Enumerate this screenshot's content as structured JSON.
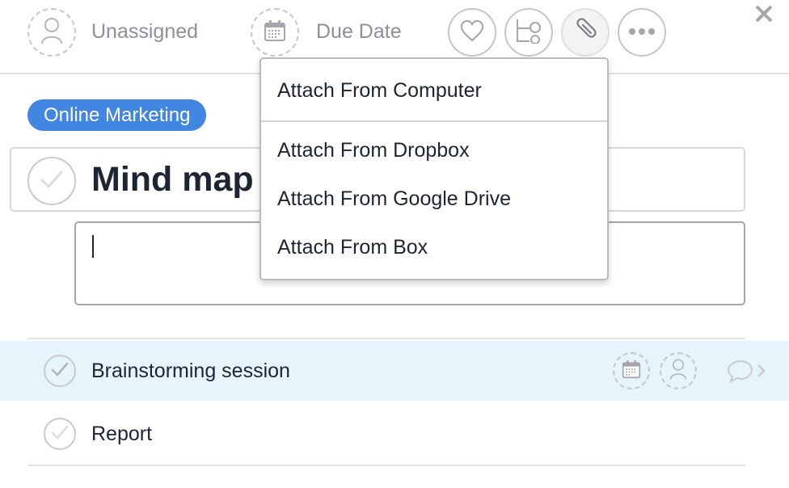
{
  "header": {
    "assignee": {
      "label": "Unassigned",
      "icon": "person-icon"
    },
    "due_date": {
      "label": "Due Date",
      "icon": "calendar-icon"
    },
    "actions": [
      {
        "name": "like",
        "icon": "heart-icon"
      },
      {
        "name": "subtasks",
        "icon": "subtask-icon"
      },
      {
        "name": "attach",
        "icon": "paperclip-icon",
        "active": true
      },
      {
        "name": "more",
        "icon": "ellipsis-icon"
      }
    ],
    "close_icon": "close-icon"
  },
  "tag": {
    "label": "Online Marketing",
    "color": "#4186e0"
  },
  "task": {
    "title": "Mind map",
    "completed": false,
    "description": {
      "value": "",
      "placeholder": ""
    }
  },
  "subtasks": [
    {
      "label": "Brainstorming session",
      "completed": false,
      "highlighted": true
    },
    {
      "label": "Report",
      "completed": false,
      "highlighted": false
    }
  ],
  "attach_menu": {
    "items": [
      {
        "label": "Attach From Computer"
      },
      {
        "label": "Attach From Dropbox"
      },
      {
        "label": "Attach From Google Drive"
      },
      {
        "label": "Attach From Box"
      }
    ]
  },
  "colors": {
    "accent": "#4186e0",
    "highlight_row": "#e6f4fb",
    "text": "#1e2532",
    "muted": "#8d9097"
  }
}
